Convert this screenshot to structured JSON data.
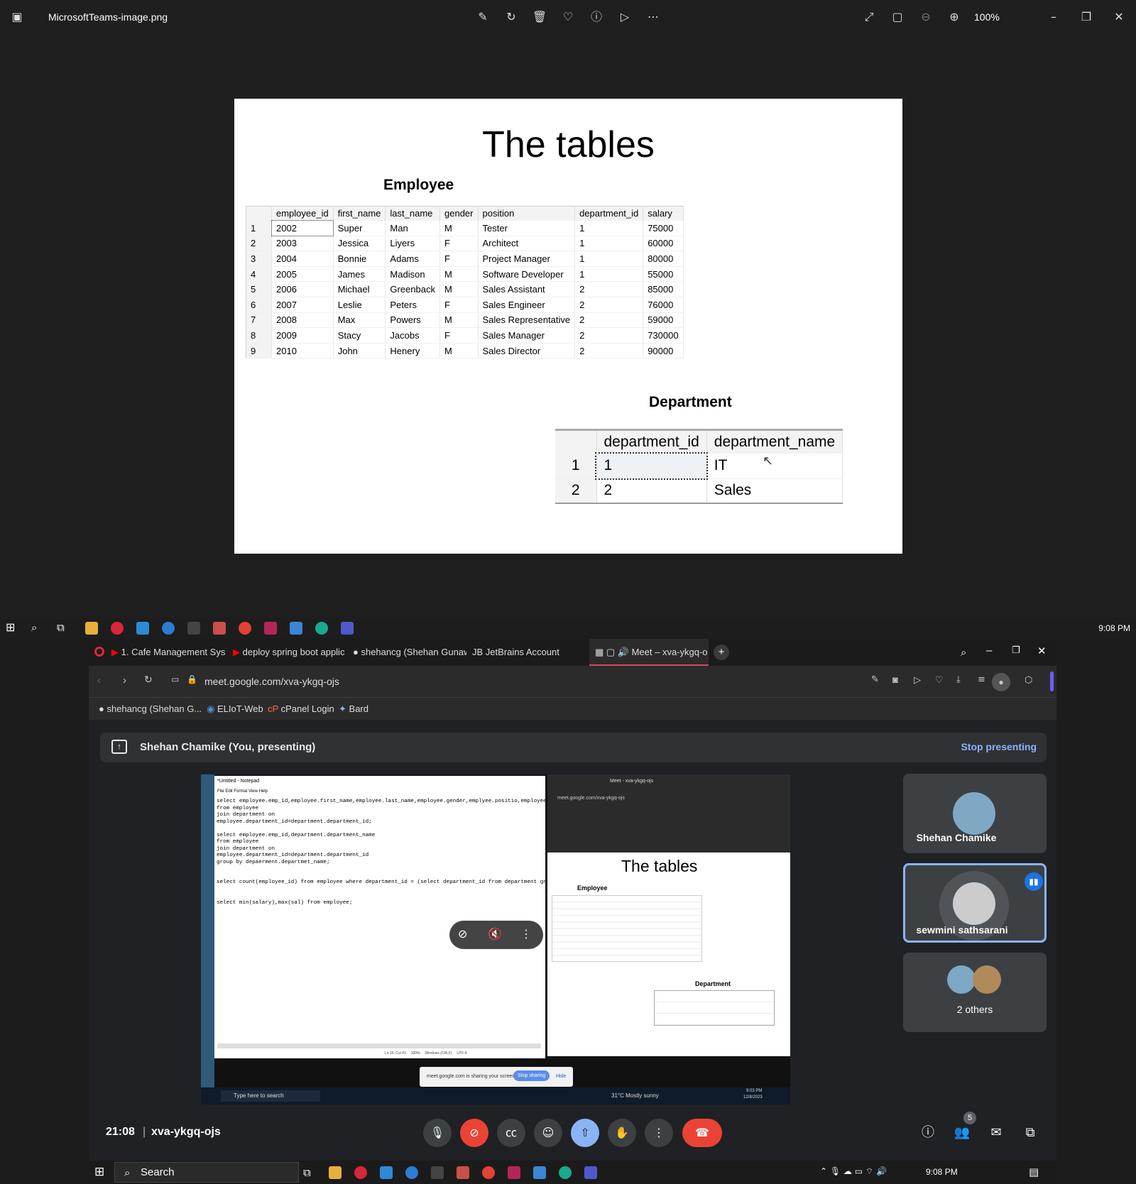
{
  "viewer": {
    "title": "MicrosoftTeams-image.png",
    "zoom": "100%"
  },
  "slide": {
    "title": "The tables",
    "employee_caption": "Employee",
    "employee_columns": [
      "employee_id",
      "first_name",
      "last_name",
      "gender",
      "position",
      "department_id",
      "salary"
    ],
    "employee_rows": [
      [
        "1",
        "2002",
        "Super",
        "Man",
        "M",
        "Tester",
        "1",
        "75000"
      ],
      [
        "2",
        "2003",
        "Jessica",
        "Liyers",
        "F",
        "Architect",
        "1",
        "60000"
      ],
      [
        "3",
        "2004",
        "Bonnie",
        "Adams",
        "F",
        "Project Manager",
        "1",
        "80000"
      ],
      [
        "4",
        "2005",
        "James",
        "Madison",
        "M",
        "Software Developer",
        "1",
        "55000"
      ],
      [
        "5",
        "2006",
        "Michael",
        "Greenback",
        "M",
        "Sales Assistant",
        "2",
        "85000"
      ],
      [
        "6",
        "2007",
        "Leslie",
        "Peters",
        "F",
        "Sales Engineer",
        "2",
        "76000"
      ],
      [
        "7",
        "2008",
        "Max",
        "Powers",
        "M",
        "Sales Representative",
        "2",
        "59000"
      ],
      [
        "8",
        "2009",
        "Stacy",
        "Jacobs",
        "F",
        "Sales Manager",
        "2",
        "730000"
      ],
      [
        "9",
        "2010",
        "John",
        "Henery",
        "M",
        "Sales Director",
        "2",
        "90000"
      ]
    ],
    "department_caption": "Department",
    "department_columns": [
      "department_id",
      "department_name"
    ],
    "department_rows": [
      [
        "1",
        "1",
        "IT"
      ],
      [
        "2",
        "2",
        "Sales"
      ]
    ]
  },
  "taskbar_top": {
    "time": "9:08 PM"
  },
  "browser": {
    "tabs": [
      "1. Cafe Management Syste",
      "deploy spring boot applic",
      "shehancg (Shehan Gunaw",
      "JetBrains Account",
      "Meet – xva-ykgq-o"
    ],
    "url": "meet.google.com/xva-ykgq-ojs",
    "bookmarks": [
      "shehancg (Shehan G...",
      "ELIoT-Web",
      "cPanel Login",
      "Bard"
    ]
  },
  "meet": {
    "presenting_text": "Shehan Chamike (You, presenting)",
    "stop_presenting": "Stop presenting",
    "participants": [
      "Shehan Chamike",
      "sewmini sathsarani",
      "2 others"
    ],
    "participant_count": "5",
    "clock": "21:08",
    "meeting_code": "xva-ykgq-ojs",
    "shared": {
      "notepad_title": "*Untitled - Notepad",
      "notepad_menu": "File  Edit  Format  View  Help",
      "notepad_text": "select employee.emp_id,employee.first_name,employee.last_name,employee.gender,emplyee.positio,employee.sal\nfrom employee\njoin department on\nemployee.department_id=department.department_id;\n\nselect employee.emp_id,department.department_name\nfrom employee\njoin department on\nemployee.department_id=department.department_id\ngroup by depaerment.departmet_name;\n\n\nselect count(employee_id) from employee where department_id = (select department_id from department group\n\n\nselect min(salary),max(sal) from employee;",
      "notepad_status": "Ln 16, Col 43     100%     Windows (CRLF)     UTF-8",
      "mini_url": "meet.google.com/xva-ykgq-ojs",
      "mini_tab": "Meet - xva-ykgq-ojs",
      "share_notice": "meet.google.com is sharing your screen.",
      "share_stop": "Stop sharing",
      "share_hide": "Hide",
      "search_placeholder": "Type here to search",
      "weather": "31°C  Mostly sunny",
      "time": "9:03 PM",
      "date": "12/8/2023"
    }
  },
  "taskbar_bottom": {
    "search": "Search",
    "time": "9:08 PM"
  }
}
